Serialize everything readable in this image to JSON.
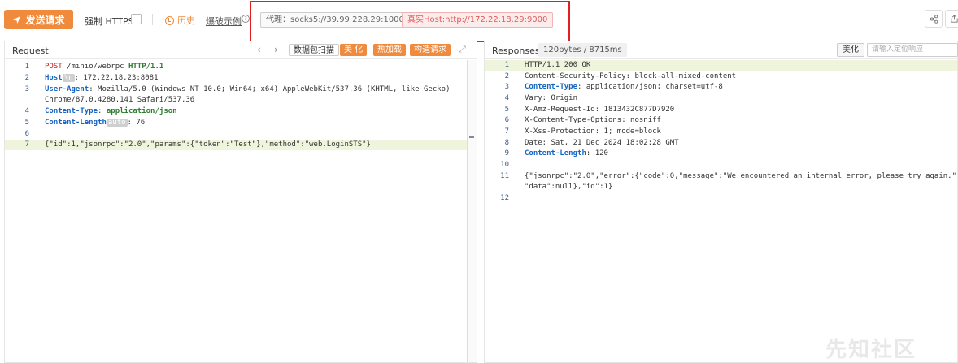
{
  "toolbar": {
    "send_label": "发送请求",
    "https_label": "强制 HTTPS",
    "history_label": "历史",
    "example_label": "爆破示例",
    "proxy_text": "代理：socks5://39.99.228.29:10000",
    "real_host_text": "真实Host:http://172.22.18.29:9000"
  },
  "request": {
    "title": "Request",
    "buttons": {
      "scan": "数据包扫描",
      "beautify": "美 化",
      "hotload": "热加载",
      "build": "构造请求"
    },
    "lines": [
      {
        "n": "1",
        "parts": [
          {
            "t": "POST",
            "c": "k-red"
          },
          {
            "t": " /minio/webrpc ",
            "c": ""
          },
          {
            "t": "HTTP/1.1",
            "c": "k-green"
          }
        ]
      },
      {
        "n": "2",
        "parts": [
          {
            "t": "Host",
            "c": "k-blue"
          },
          {
            "t": "\\n",
            "c": "auto-badge"
          },
          {
            "t": ": 172.22.18.23:8081",
            "c": ""
          }
        ]
      },
      {
        "n": "3",
        "parts": [
          {
            "t": "User-Agent",
            "c": "k-blue"
          },
          {
            "t": ": Mozilla/5.0 (Windows NT 10.0; Win64; x64) AppleWebKit/537.36 (KHTML, like Gecko)",
            "c": ""
          }
        ]
      },
      {
        "n": "",
        "parts": [
          {
            "t": "Chrome/87.0.4280.141 Safari/537.36",
            "c": ""
          }
        ]
      },
      {
        "n": "4",
        "parts": [
          {
            "t": "Content-Type",
            "c": "k-blue"
          },
          {
            "t": ": ",
            "c": ""
          },
          {
            "t": "application/json",
            "c": "k-green"
          }
        ]
      },
      {
        "n": "5",
        "parts": [
          {
            "t": "Content-Length",
            "c": "k-blue"
          },
          {
            "t": "auto",
            "c": "auto-badge"
          },
          {
            "t": ": 76",
            "c": ""
          }
        ]
      },
      {
        "n": "6",
        "parts": []
      },
      {
        "n": "7",
        "parts": [
          {
            "t": "{\"id\":1,\"jsonrpc\":\"2.0\",\"params\":{\"token\":\"Test\"},\"method\":\"web.LoginSTS\"}",
            "c": ""
          }
        ]
      }
    ]
  },
  "response": {
    "title": "Responses",
    "meta": "120bytes / 8715ms",
    "beautify": "美化",
    "search_placeholder": "请输入定位响应",
    "lines": [
      {
        "n": "1",
        "parts": [
          {
            "t": "HTTP/1.1 200 OK",
            "c": ""
          }
        ]
      },
      {
        "n": "2",
        "parts": [
          {
            "t": "Content-Security-Policy: block-all-mixed-content",
            "c": ""
          }
        ]
      },
      {
        "n": "3",
        "parts": [
          {
            "t": "Content-Type",
            "c": "k-blue"
          },
          {
            "t": ": application/json; charset=utf-8",
            "c": ""
          }
        ]
      },
      {
        "n": "4",
        "parts": [
          {
            "t": "Vary: Origin",
            "c": ""
          }
        ]
      },
      {
        "n": "5",
        "parts": [
          {
            "t": "X-Amz-Request-Id: 1813432C877D7920",
            "c": ""
          }
        ]
      },
      {
        "n": "6",
        "parts": [
          {
            "t": "X-Content-Type-Options: nosniff",
            "c": ""
          }
        ]
      },
      {
        "n": "7",
        "parts": [
          {
            "t": "X-Xss-Protection: 1; mode=block",
            "c": ""
          }
        ]
      },
      {
        "n": "8",
        "parts": [
          {
            "t": "Date: Sat, 21 Dec 2024 18:02:28 GMT",
            "c": ""
          }
        ]
      },
      {
        "n": "9",
        "parts": [
          {
            "t": "Content-Length",
            "c": "k-blue"
          },
          {
            "t": ": 120",
            "c": ""
          }
        ]
      },
      {
        "n": "10",
        "parts": []
      },
      {
        "n": "11",
        "parts": [
          {
            "t": "{\"jsonrpc\":\"2.0\",\"error\":{\"code\":0,\"message\":\"We encountered an internal error, please try again.\",",
            "c": ""
          }
        ]
      },
      {
        "n": "",
        "parts": [
          {
            "t": "\"data\":null},\"id\":1}",
            "c": ""
          }
        ]
      },
      {
        "n": "12",
        "parts": []
      }
    ]
  },
  "watermark": "先知社区",
  "colors": {
    "accent": "#f08a3c",
    "highlight": "#e02020",
    "active_line": "#eef5dc"
  }
}
